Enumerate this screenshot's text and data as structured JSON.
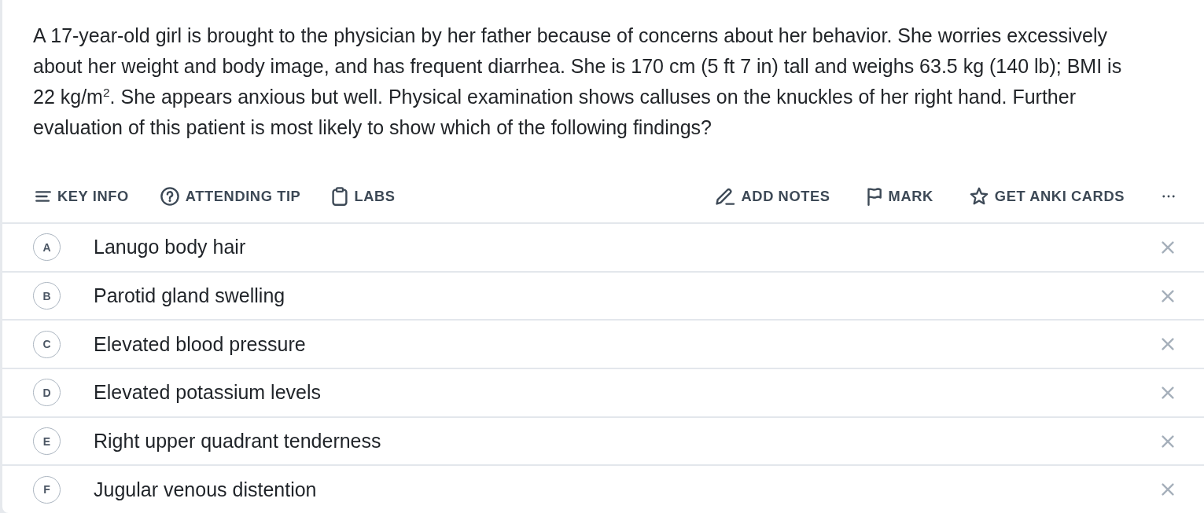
{
  "question": {
    "text": "A 17-year-old girl is brought to the physician by her father because of concerns about her behavior. She worries excessively about her weight and body image, and has frequent diarrhea. She is 170 cm (5 ft 7 in) tall and weighs 63.5 kg (140 lb); BMI is 22 kg/m$^{2}$. She appears anxious but well. Physical examination shows calluses on the knuckles of her right hand. Further evaluation of this patient is most likely to show which of the following findings?"
  },
  "toolbar": {
    "left": [
      {
        "kind": "key_info",
        "label": "KEY INFO"
      },
      {
        "kind": "attending_tip",
        "label": "ATTENDING TIP"
      },
      {
        "kind": "labs",
        "label": "LABS"
      }
    ],
    "right": [
      {
        "kind": "add_notes",
        "label": "ADD NOTES"
      },
      {
        "kind": "mark",
        "label": "MARK"
      },
      {
        "kind": "anki",
        "label": "GET ANKI CARDS"
      },
      {
        "kind": "more"
      }
    ]
  },
  "options": [
    {
      "letter": "A",
      "text": "Lanugo body hair"
    },
    {
      "letter": "B",
      "text": "Parotid gland swelling"
    },
    {
      "letter": "C",
      "text": "Elevated blood pressure"
    },
    {
      "letter": "D",
      "text": "Elevated potassium levels"
    },
    {
      "letter": "E",
      "text": "Right upper quadrant tenderness"
    },
    {
      "letter": "F",
      "text": "Jugular venous distention"
    }
  ]
}
